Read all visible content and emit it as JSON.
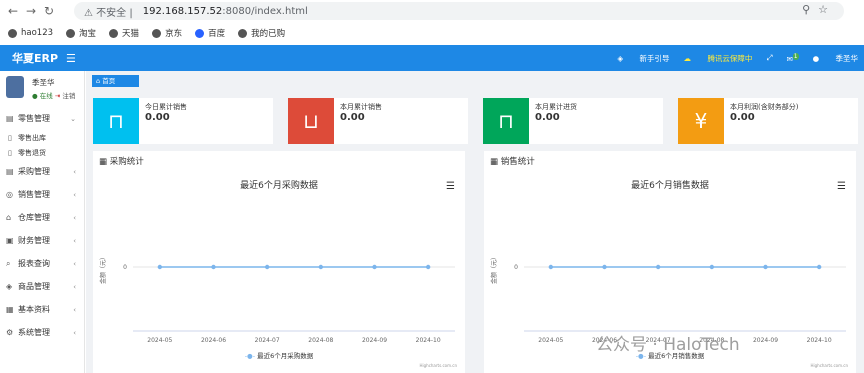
{
  "browser": {
    "security_label": "不安全",
    "url_host": "192.168.157.52",
    "url_path": ":8080/index.html",
    "bookmarks": [
      "hao123",
      "淘宝",
      "天猫",
      "京东",
      "百度",
      "我的已购"
    ]
  },
  "topbar": {
    "brand": "华夏ERP",
    "guide": "新手引导",
    "cloud": "腾讯云保障中",
    "msg_count": "1",
    "user": "季圣华"
  },
  "sidebar": {
    "user_name": "季圣华",
    "status_online": "在线",
    "status_logout": "注销",
    "menus": [
      {
        "label": "零售管理",
        "subs": [
          "零售出库",
          "零售退货"
        ]
      },
      {
        "label": "采购管理"
      },
      {
        "label": "销售管理"
      },
      {
        "label": "仓库管理"
      },
      {
        "label": "财务管理"
      },
      {
        "label": "报表查询"
      },
      {
        "label": "商品管理"
      },
      {
        "label": "基本资料"
      },
      {
        "label": "系统管理"
      }
    ]
  },
  "breadcrumb": "首页",
  "stats": [
    {
      "label": "今日累计销售",
      "value": "0.00",
      "color": "#00c0ef"
    },
    {
      "label": "本月累计销售",
      "value": "0.00",
      "color": "#dd4b39"
    },
    {
      "label": "本月累计进货",
      "value": "0.00",
      "color": "#00a65a"
    },
    {
      "label": "本月利润(含财务部分)",
      "value": "0.00",
      "color": "#f39c12"
    }
  ],
  "panels": [
    {
      "title": "采购统计",
      "chart_title": "最近6个月采购数据",
      "legend": "最近6个月采购数据"
    },
    {
      "title": "销售统计",
      "chart_title": "最近6个月销售数据",
      "legend": "最近6个月销售数据"
    }
  ],
  "chart_data": [
    {
      "type": "line",
      "title": "最近6个月采购数据",
      "ylabel": "金额（元）",
      "x": [
        "2024-05",
        "2024-06",
        "2024-07",
        "2024-08",
        "2024-09",
        "2024-10"
      ],
      "series": [
        {
          "name": "最近6个月采购数据",
          "values": [
            0,
            0,
            0,
            0,
            0,
            0
          ]
        }
      ],
      "yticks": [
        "0"
      ],
      "color": "#7cb5ec",
      "credit": "Highcharts.com.cn"
    },
    {
      "type": "line",
      "title": "最近6个月销售数据",
      "ylabel": "金额（元）",
      "x": [
        "2024-05",
        "2024-06",
        "2024-07",
        "2024-08",
        "2024-09",
        "2024-10"
      ],
      "series": [
        {
          "name": "最近6个月销售数据",
          "values": [
            0,
            0,
            0,
            0,
            0,
            0
          ]
        }
      ],
      "yticks": [
        "0"
      ],
      "color": "#7cb5ec",
      "credit": "Highcharts.com.cn"
    }
  ],
  "watermark": "公众号 · HaloTech"
}
